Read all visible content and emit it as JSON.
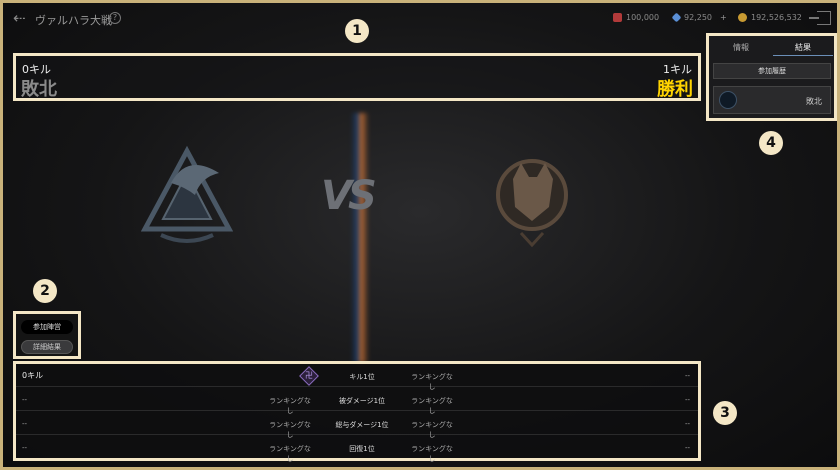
{
  "header": {
    "title": "ヴァルハラ大戦",
    "help": "?",
    "currencies": [
      {
        "icon": "ruby-icon",
        "color": "#b23a3a",
        "value": "100,000"
      },
      {
        "icon": "diamond-icon",
        "color": "#5a8fd6",
        "value": "92,250",
        "plus": "+"
      },
      {
        "icon": "gold-coin-icon",
        "color": "#c89a32",
        "value": "192,526,532"
      }
    ]
  },
  "score": {
    "left_kills": "0キル",
    "left_result": "敗北",
    "right_kills": "1キル",
    "right_result": "勝利"
  },
  "center": {
    "vs": "VS"
  },
  "buttons": {
    "participation": "参加陣営",
    "details": "詳細結果"
  },
  "ranking": {
    "rows": [
      {
        "left": "0キル",
        "left_rank": "",
        "label": "キル1位",
        "right_rank": "ランキングなし",
        "right": "--"
      },
      {
        "left": "--",
        "left_rank": "ランキングなし",
        "label": "被ダメージ1位",
        "right_rank": "ランキングなし",
        "right": "--"
      },
      {
        "left": "--",
        "left_rank": "ランキングなし",
        "label": "総与ダメージ1位",
        "right_rank": "ランキングなし",
        "right": "--"
      },
      {
        "left": "--",
        "left_rank": "ランキングなし",
        "label": "回復1位",
        "right_rank": "ランキングなし",
        "right": "--"
      }
    ]
  },
  "right_panel": {
    "tabs": [
      "情報",
      "結果"
    ],
    "history_label": "参加履歴",
    "entry_result": "敗北"
  },
  "badges": [
    "1",
    "2",
    "3",
    "4"
  ]
}
